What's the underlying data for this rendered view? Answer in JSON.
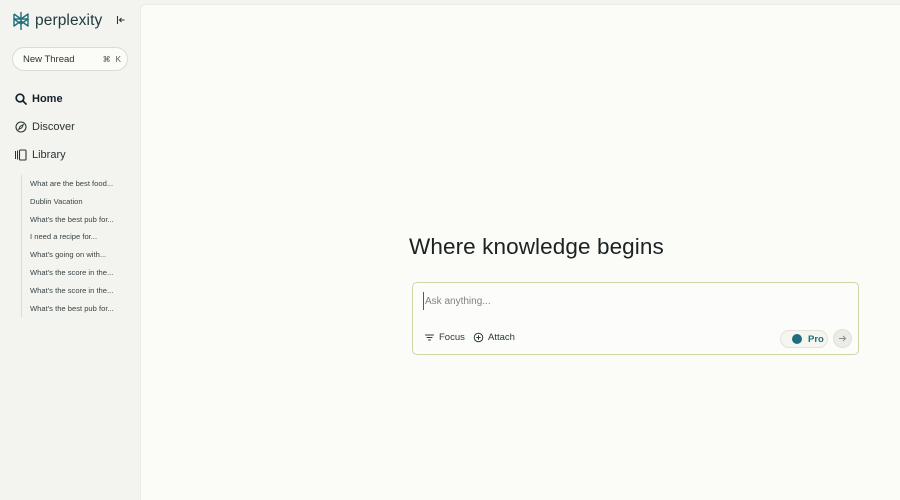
{
  "brand": {
    "name": "perplexity",
    "logo_icon": "perplexity-logo-icon",
    "accent": "#1f6e7d"
  },
  "sidebar": {
    "collapse_icon": "collapse-sidebar-icon",
    "new_thread": {
      "label": "New Thread",
      "shortcut_cmd": "⌘",
      "shortcut_key": "K"
    },
    "nav": [
      {
        "label": "Home",
        "icon": "search-icon",
        "active": true
      },
      {
        "label": "Discover",
        "icon": "compass-icon"
      },
      {
        "label": "Library",
        "icon": "library-icon"
      }
    ],
    "library_items": [
      "What are the best food...",
      "Dublin Vacation",
      "What's the best pub for...",
      "I need a recipe for...",
      "What's going on with...",
      "What's the score in the...",
      "What's the score in the...",
      "What's the best pub for..."
    ]
  },
  "main": {
    "headline": "Where knowledge begins",
    "ask": {
      "placeholder": "Ask anything...",
      "focus_label": "Focus",
      "attach_label": "Attach",
      "pro_label": "Pro",
      "pro_enabled": true,
      "submit_icon": "arrow-right-icon"
    }
  }
}
